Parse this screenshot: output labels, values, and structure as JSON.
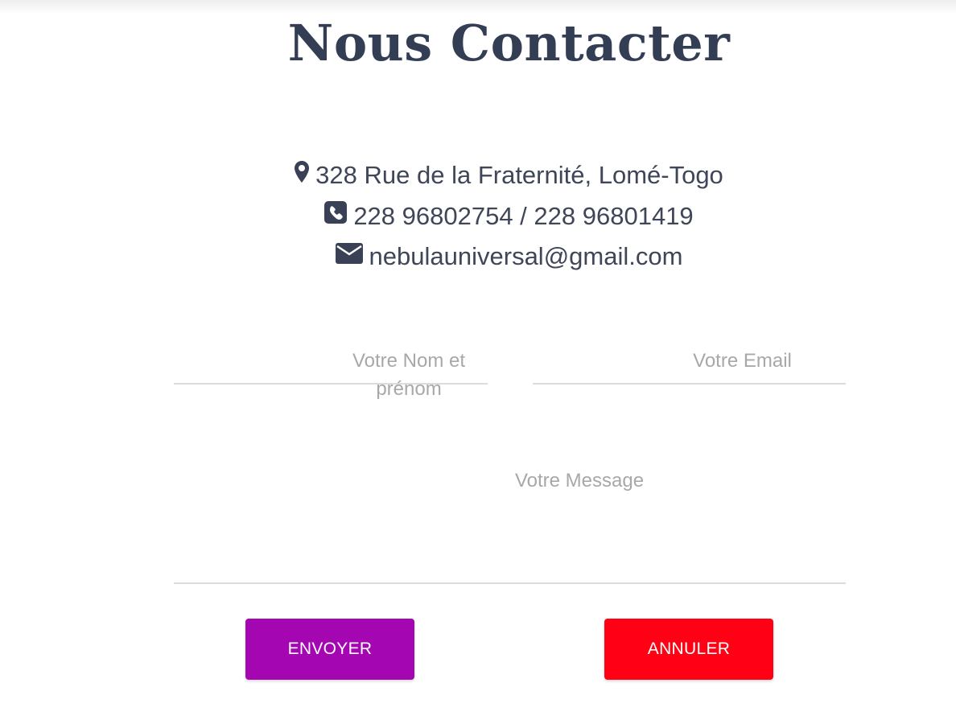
{
  "page": {
    "title": "Nous Contacter"
  },
  "contact": {
    "address": {
      "icon": "map-marker-icon",
      "text": "328 Rue de la Fraternité, Lomé-Togo"
    },
    "phone": {
      "icon": "phone-square-icon",
      "text": "228 96802754 / 228 96801419"
    },
    "email": {
      "icon": "envelope-icon",
      "text": "nebulauniversal@gmail.com"
    }
  },
  "form": {
    "name_field": {
      "value": "",
      "placeholder": "Votre Nom et prénom"
    },
    "email_field": {
      "value": "",
      "placeholder": "Votre Email"
    },
    "message_field": {
      "value": "",
      "placeholder": "Votre Message"
    },
    "send_button": {
      "label": "ENVOYER",
      "color": "#a406b1"
    },
    "cancel_button": {
      "label": "ANNULER",
      "color": "#ff0015"
    }
  }
}
